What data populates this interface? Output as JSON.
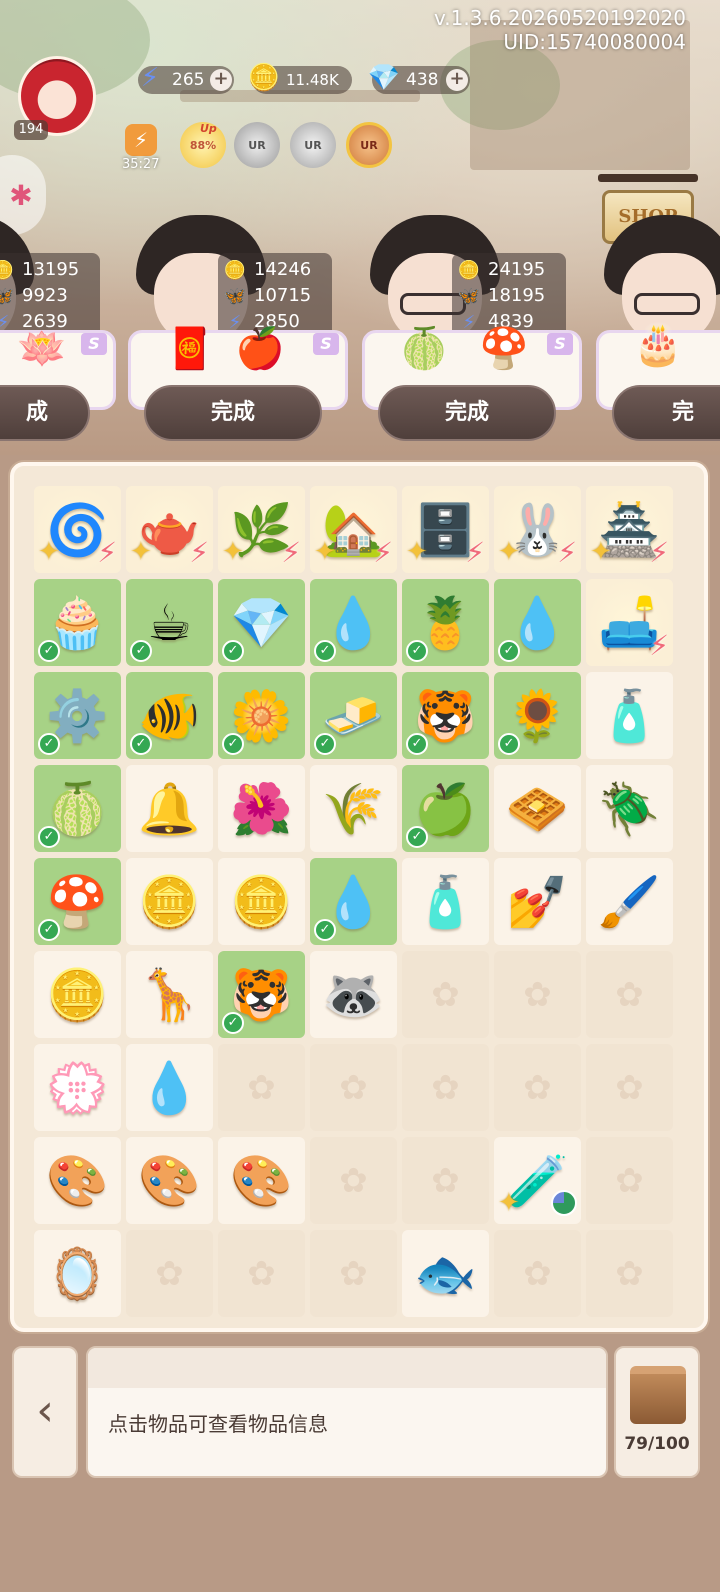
{
  "header": {
    "version": "v.1.3.6.20260520192020",
    "uid": "UID:15740080004",
    "player_level": "194",
    "energy": "265",
    "coins": "11.48K",
    "gems": "438",
    "energy_timer": "35:27",
    "boost_badge": "88%",
    "boost_up": "Up",
    "ur_badge_label": "UR",
    "shop_label": "SHOP",
    "energy_icon": "lightning-icon",
    "coin_icon": "clover-coin-icon",
    "gem_icon": "gem-icon",
    "plus_icon": "plus-icon"
  },
  "customers": [
    {
      "coins": "13195",
      "butterflies": "9923",
      "energy": "2639",
      "done_label": "成",
      "items": [
        "🪷"
      ],
      "tag": "S"
    },
    {
      "coins": "14246",
      "butterflies": "10715",
      "energy": "2850",
      "done_label": "完成",
      "items": [
        "🧧",
        "🍎"
      ],
      "tag": "S"
    },
    {
      "coins": "24195",
      "butterflies": "18195",
      "energy": "4839",
      "done_label": "完成",
      "items": [
        "🍈",
        "🍄"
      ],
      "tag": "S"
    },
    {
      "coins": "",
      "butterflies": "",
      "energy": "",
      "done_label": "完",
      "items": [
        "🎂"
      ],
      "tag": ""
    }
  ],
  "board": {
    "rows": [
      [
        {
          "icon": "🌀",
          "bg": "glow",
          "badge": "gen"
        },
        {
          "icon": "🫖",
          "bg": "glow",
          "badge": "gen"
        },
        {
          "icon": "🌿",
          "bg": "glow",
          "badge": "gen"
        },
        {
          "icon": "🏡",
          "bg": "glow",
          "badge": "gen"
        },
        {
          "icon": "🗄️",
          "bg": "glow",
          "badge": "gen"
        },
        {
          "icon": "🐰",
          "bg": "glow",
          "badge": "gen"
        },
        {
          "icon": "🏯",
          "bg": "glow",
          "badge": "gen"
        }
      ],
      [
        {
          "icon": "🧁",
          "bg": "green",
          "badge": "check"
        },
        {
          "icon": "☕",
          "bg": "green",
          "badge": "check"
        },
        {
          "icon": "💎",
          "bg": "green",
          "badge": "check"
        },
        {
          "icon": "💧",
          "bg": "green",
          "badge": "check"
        },
        {
          "icon": "🍍",
          "bg": "green",
          "badge": "check"
        },
        {
          "icon": "💧",
          "bg": "green",
          "badge": "check"
        },
        {
          "icon": "🛋️",
          "bg": "glow",
          "badge": "bolt"
        }
      ],
      [
        {
          "icon": "⚙️",
          "bg": "green",
          "badge": "check"
        },
        {
          "icon": "🐠",
          "bg": "green",
          "badge": "check"
        },
        {
          "icon": "🌼",
          "bg": "green",
          "badge": "check"
        },
        {
          "icon": "🧈",
          "bg": "green",
          "badge": "check"
        },
        {
          "icon": "🐯",
          "bg": "green",
          "badge": "check"
        },
        {
          "icon": "🌻",
          "bg": "green",
          "badge": "check"
        },
        {
          "icon": "🧴",
          "bg": "plain",
          "badge": ""
        }
      ],
      [
        {
          "icon": "🍈",
          "bg": "green",
          "badge": "check"
        },
        {
          "icon": "🔔",
          "bg": "plain",
          "badge": ""
        },
        {
          "icon": "🌺",
          "bg": "plain",
          "badge": ""
        },
        {
          "icon": "🌾",
          "bg": "plain",
          "badge": ""
        },
        {
          "icon": "🍏",
          "bg": "green",
          "badge": "check"
        },
        {
          "icon": "🧇",
          "bg": "plain",
          "badge": ""
        },
        {
          "icon": "🪲",
          "bg": "plain",
          "badge": ""
        }
      ],
      [
        {
          "icon": "🍄",
          "bg": "green",
          "badge": "check"
        },
        {
          "icon": "🪙",
          "bg": "plain",
          "badge": ""
        },
        {
          "icon": "🪙",
          "bg": "plain",
          "badge": ""
        },
        {
          "icon": "💧",
          "bg": "green",
          "badge": "check"
        },
        {
          "icon": "🧴",
          "bg": "plain",
          "badge": ""
        },
        {
          "icon": "💅",
          "bg": "plain",
          "badge": ""
        },
        {
          "icon": "🖌️",
          "bg": "plain",
          "badge": ""
        }
      ],
      [
        {
          "icon": "🪙",
          "bg": "plain",
          "badge": ""
        },
        {
          "icon": "🦒",
          "bg": "plain",
          "badge": ""
        },
        {
          "icon": "🐯",
          "bg": "green",
          "badge": "check"
        },
        {
          "icon": "🦝",
          "bg": "plain",
          "badge": ""
        },
        {
          "icon": "",
          "bg": "empty",
          "badge": ""
        },
        {
          "icon": "",
          "bg": "empty",
          "badge": ""
        },
        {
          "icon": "",
          "bg": "empty",
          "badge": ""
        }
      ],
      [
        {
          "icon": "💮",
          "bg": "plain",
          "badge": ""
        },
        {
          "icon": "💧",
          "bg": "plain",
          "badge": ""
        },
        {
          "icon": "",
          "bg": "empty",
          "badge": ""
        },
        {
          "icon": "",
          "bg": "empty",
          "badge": ""
        },
        {
          "icon": "",
          "bg": "empty",
          "badge": ""
        },
        {
          "icon": "",
          "bg": "empty",
          "badge": ""
        },
        {
          "icon": "",
          "bg": "empty",
          "badge": ""
        }
      ],
      [
        {
          "icon": "🎨",
          "bg": "plain",
          "badge": ""
        },
        {
          "icon": "🎨",
          "bg": "plain",
          "badge": ""
        },
        {
          "icon": "🎨",
          "bg": "plain",
          "badge": ""
        },
        {
          "icon": "",
          "bg": "empty",
          "badge": ""
        },
        {
          "icon": "",
          "bg": "empty",
          "badge": ""
        },
        {
          "icon": "🧪",
          "bg": "plain",
          "badge": "timer"
        },
        {
          "icon": "",
          "bg": "empty",
          "badge": ""
        }
      ],
      [
        {
          "icon": "🪞",
          "bg": "plain",
          "badge": ""
        },
        {
          "icon": "",
          "bg": "empty",
          "badge": ""
        },
        {
          "icon": "",
          "bg": "empty",
          "badge": ""
        },
        {
          "icon": "",
          "bg": "empty",
          "badge": ""
        },
        {
          "icon": "🐟",
          "bg": "plain",
          "badge": ""
        },
        {
          "icon": "",
          "bg": "empty",
          "badge": ""
        },
        {
          "icon": "",
          "bg": "empty",
          "badge": ""
        }
      ]
    ]
  },
  "footer": {
    "back_icon": "chevron-left-icon",
    "info_text": "点击物品可查看物品信息",
    "storage_count": "79/100",
    "storage_icon": "box-icon"
  },
  "colors": {
    "check": "#35a853",
    "green_cell": "#a7d286",
    "bolt": "#f06a7a",
    "spark": "#f3c13a"
  }
}
